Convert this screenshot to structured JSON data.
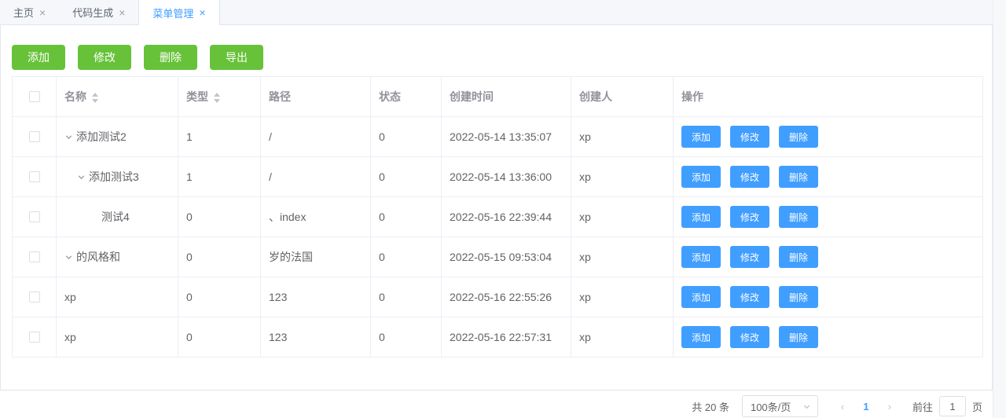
{
  "colors": {
    "blue": "#409eff",
    "green": "#67c23a"
  },
  "icons": {
    "close": "×"
  },
  "tabs": [
    {
      "label": "主页",
      "active": false
    },
    {
      "label": "代码生成",
      "active": false
    },
    {
      "label": "菜单管理",
      "active": true
    }
  ],
  "toolbar": {
    "buttons": [
      "添加",
      "修改",
      "删除",
      "导出"
    ]
  },
  "table": {
    "columns": [
      {
        "label": "",
        "checkbox": true
      },
      {
        "label": "名称",
        "sortable": true
      },
      {
        "label": "类型",
        "sortable": true
      },
      {
        "label": "路径"
      },
      {
        "label": "状态"
      },
      {
        "label": "创建时间"
      },
      {
        "label": "创建人"
      },
      {
        "label": "操作"
      }
    ],
    "row_actions": [
      "添加",
      "修改",
      "删除"
    ],
    "row_action_names": [
      "add",
      "edit",
      "delete"
    ],
    "rows": [
      {
        "name": "添加测试2",
        "level": 0,
        "expandable": true,
        "type": "1",
        "path": "/",
        "status": "0",
        "created": "2022-05-14 13:35:07",
        "creator": "xp"
      },
      {
        "name": "添加测试3",
        "level": 1,
        "expandable": true,
        "type": "1",
        "path": "/",
        "status": "0",
        "created": "2022-05-14 13:36:00",
        "creator": "xp"
      },
      {
        "name": "测试4",
        "level": 2,
        "expandable": false,
        "type": "0",
        "path": "、index",
        "status": "0",
        "created": "2022-05-16 22:39:44",
        "creator": "xp"
      },
      {
        "name": "的风格和",
        "level": 0,
        "expandable": true,
        "type": "0",
        "path": "岁的法国",
        "status": "0",
        "created": "2022-05-15 09:53:04",
        "creator": "xp"
      },
      {
        "name": "xp",
        "level": 0,
        "expandable": false,
        "type": "0",
        "path": "123",
        "status": "0",
        "created": "2022-05-16 22:55:26",
        "creator": "xp"
      },
      {
        "name": "xp",
        "level": 0,
        "expandable": false,
        "type": "0",
        "path": "123",
        "status": "0",
        "created": "2022-05-16 22:57:31",
        "creator": "xp"
      }
    ]
  },
  "pagination": {
    "total_label": "共 20 条",
    "page_size": "100条/页",
    "prev": "‹",
    "next": "›",
    "current_page": "1",
    "goto_label": "前往",
    "goto_value": "1",
    "page_unit": "页"
  }
}
